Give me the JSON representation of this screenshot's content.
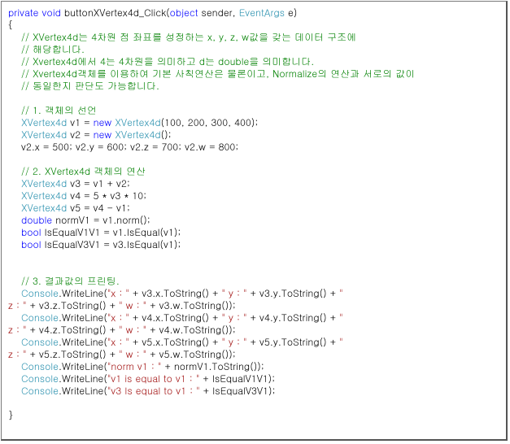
{
  "sig_kw1": "private",
  "sig_kw2": "void",
  "sig_name": " buttonXVertex4d_Click(",
  "sig_kw3": "object",
  "sig_mid": " sender, ",
  "sig_type": "EventArgs",
  "sig_end": " e)",
  "brace_open": "{",
  "c1": "    // XVertex4d는 4차원 점 좌표를 성정하는 x, y, z, w값을 갖는 데이터 구조에",
  "c2": "    // 해당합니다.",
  "c3": "    // Xvertex4d에서 4는 4차원을 의미하고 d는 double을 의미합니다.",
  "c4": "    // Xvertex4d객체를 이용하여 기본 사칙연산은 물론이고, Normalize의 연산과 서로의 값이",
  "c5": "    // 동일한지 판단도 가능합니다.",
  "blank": "",
  "c6": "    // 1. 객체의 선언",
  "l1_a": "XVertex4d",
  "l1_b": " v1 = ",
  "l1_c": "new",
  "l1_d": "XVertex4d",
  "l1_e": "(100, 200, 300, 400);",
  "l2_a": "XVertex4d",
  "l2_b": " v2 = ",
  "l2_c": "new",
  "l2_d": "XVertex4d",
  "l2_e": "();",
  "l3": "    v2.x = 500; v2.y = 600; v2.z = 700; v2.w = 800;",
  "c7": "    // 2. XVertex4d 객체의 연산",
  "l4_a": "XVertex4d",
  "l4_b": " v3 = v1 + v2;",
  "l5_a": "XVertex4d",
  "l5_b": " v4 = 5 * v3 * 10;",
  "l6_a": "XVertex4d",
  "l6_b": " v5 = v4 - v1;",
  "l7_a": "double",
  "l7_b": " normV1 = v1.norm();",
  "l8_a": "bool",
  "l8_b": " IsEqualV1V1 = v1.IsEqual(v1);",
  "l9_a": "bool",
  "l9_b": " IsEqualV3V1 = v3.IsEqual(v1);",
  "c8": "    // 3. 결과값의 프린팅.",
  "out1_a": "Console",
  "out1_b": ".WriteLine(",
  "out1_s1": "\"x : \"",
  "out1_c": " + v3.x.ToString() + ",
  "out1_s2": "\" y : \"",
  "out1_d": " + v3.y.ToString() + ",
  "out1_s3": "\"",
  "out1c_s1": "z : \"",
  "out1c_a": " + v3.z.ToString() + ",
  "out1c_s2": "\" w : \"",
  "out1c_b": " + v3.w.ToString());",
  "out2_a": "Console",
  "out2_b": ".WriteLine(",
  "out2_s1": "\"x : \"",
  "out2_c": " + v4.x.ToString() + ",
  "out2_s2": "\" y : \"",
  "out2_d": " + v4.y.ToString() + ",
  "out2_s3": "\"",
  "out2c_s1": "z : \"",
  "out2c_a": " + v4.z.ToString() + ",
  "out2c_s2": "\" w : \"",
  "out2c_b": " + v4.w.ToString());",
  "out3_a": "Console",
  "out3_b": ".WriteLine(",
  "out3_s1": "\"x : \"",
  "out3_c": " + v5.x.ToString() + ",
  "out3_s2": "\" y : \"",
  "out3_d": " + v5.y.ToString() + ",
  "out3_s3": "\"",
  "out3c_s1": "z : \"",
  "out3c_a": " + v5.z.ToString() + ",
  "out3c_s2": "\" w : \"",
  "out3c_b": " + v5.w.ToString());",
  "out4_a": "Console",
  "out4_b": ".WriteLine(",
  "out4_s1": "\"norm v1 : \"",
  "out4_c": " + normV1.ToString());",
  "out5_a": "Console",
  "out5_b": ".WriteLine(",
  "out5_s1": "\"v1 is equal to v1 : \"",
  "out5_c": " + IsEqualV1V1);",
  "out6_a": "Console",
  "out6_b": ".WriteLine(",
  "out6_s1": "\"v3 Is equal to v1 : \"",
  "out6_c": " + IsEqualV3V1);",
  "brace_close": "}",
  "indent4": "    "
}
